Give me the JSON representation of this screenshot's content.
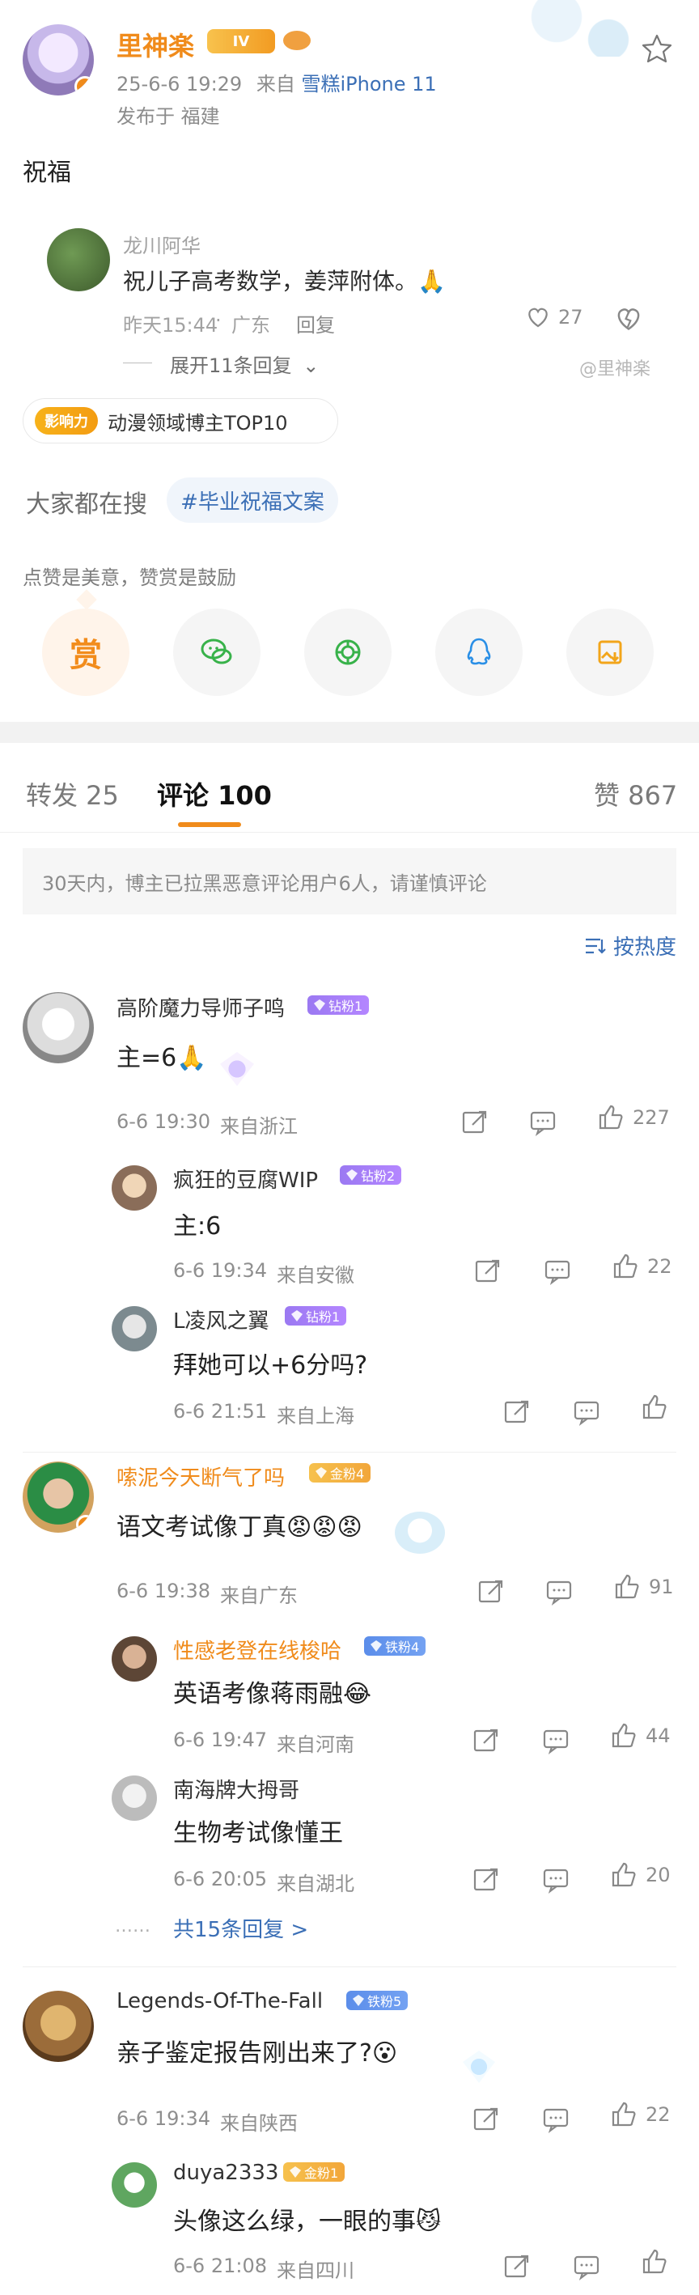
{
  "post": {
    "author": {
      "name": "里神楽",
      "level_badge": "IV"
    },
    "meta": {
      "time": "25-6-6 19:29",
      "source_prefix": "来自",
      "source": "雪糕iPhone 11",
      "location": "发布于 福建"
    },
    "content": "祝福",
    "quote": {
      "author": "龙川阿华",
      "text": "祝儿子高考数学，姜萍附体。🙏",
      "time": "昨天15:44",
      "region": "广东",
      "reply_label": "回复",
      "like_count": "27",
      "expand_label": "展开11条回复",
      "watermark": "@里神楽"
    },
    "influence": {
      "badge_label": "影响力",
      "text": "动漫领域博主TOP10"
    },
    "search": {
      "label": "大家都在搜",
      "tag": "#毕业祝福文案"
    },
    "reward": {
      "hint": "点赞是美意，赞赏是鼓励",
      "buttons": [
        {
          "name": "reward",
          "label": "赏",
          "icon": "reward-icon"
        },
        {
          "name": "wechat",
          "icon": "wechat-icon"
        },
        {
          "name": "moments",
          "icon": "wechat-moments-icon"
        },
        {
          "name": "qq",
          "icon": "qq-icon"
        },
        {
          "name": "save-image",
          "icon": "save-image-icon"
        }
      ]
    }
  },
  "tabs": {
    "repost": "转发 25",
    "comment": "评论 100",
    "like": "赞 867"
  },
  "notice": "30天内，博主已拉黑恶意评论用户6人，请谨慎评论",
  "sort_label": "按热度",
  "comments": [
    {
      "name": "高阶魔力导师子鸣",
      "badge": "钻粉1",
      "text": "主=6🙏",
      "time": "6-6 19:30",
      "region": "来自浙江",
      "likes": "227",
      "replies": [
        {
          "name": "疯狂的豆腐WIP",
          "badge": "钻粉2",
          "text": "主:6",
          "time": "6-6 19:34",
          "region": "来自安徽",
          "likes": "22"
        },
        {
          "name": "L凌风之翼",
          "badge": "钻粉1",
          "text": "拜她可以+6分吗?",
          "time": "6-6 21:51",
          "region": "来自上海",
          "likes": ""
        }
      ]
    },
    {
      "name": "嗦泥今天断气了吗",
      "badge": "金粉4",
      "text": "语文考试像丁真😡😡😡",
      "time": "6-6 19:38",
      "region": "来自广东",
      "likes": "91",
      "replies": [
        {
          "name": "性感老登在线梭哈",
          "badge": "铁粉4",
          "text": "英语考像蒋雨融😂",
          "time": "6-6 19:47",
          "region": "来自河南",
          "likes": "44"
        },
        {
          "name": "南海牌大拇哥",
          "badge": "",
          "text": "生物考试像懂王",
          "time": "6-6 20:05",
          "region": "来自湖北",
          "likes": "20"
        }
      ],
      "more": "共15条回复 >"
    },
    {
      "name": "Legends-Of-The-Fall",
      "badge": "铁粉5",
      "text": "亲子鉴定报告刚出来了?😮",
      "time": "6-6 19:34",
      "region": "来自陕西",
      "likes": "22",
      "replies": [
        {
          "name": "duya2333",
          "badge": "金粉1",
          "text": "头像这么绿，一眼的事😼",
          "time": "6-6 21:08",
          "region": "来自四川",
          "likes": ""
        }
      ]
    }
  ],
  "colors": {
    "accent_orange": "#f08b1b",
    "link_blue": "#3b6fb6",
    "diamond_purple": "#9a7bf0",
    "gold": "#f1b335",
    "iron_blue": "#5b8dea"
  }
}
